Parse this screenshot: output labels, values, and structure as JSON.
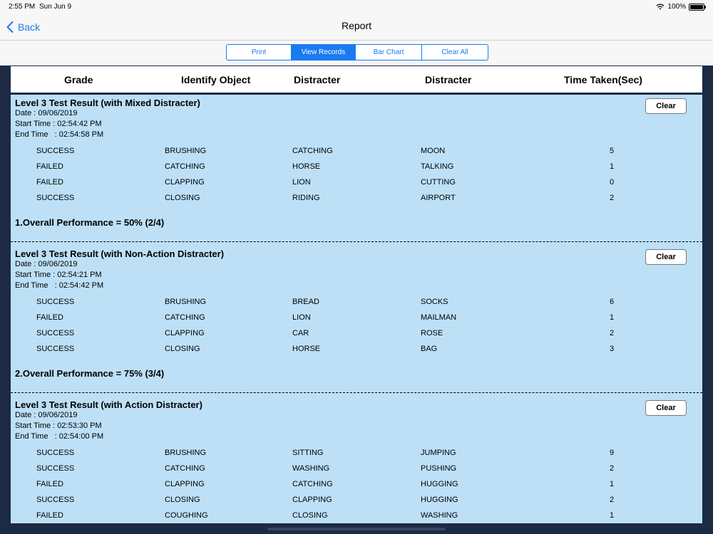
{
  "status": {
    "time": "2:55 PM",
    "date": "Sun Jun 9",
    "battery": "100%"
  },
  "nav": {
    "back_label": "Back",
    "title": "Report"
  },
  "segments": [
    "Print",
    "View Records",
    "Bar Chart",
    "Clear All"
  ],
  "columns": [
    "Grade",
    "Identify Object",
    "Distracter",
    "Distracter",
    "Time Taken(Sec)"
  ],
  "clear_label": "Clear",
  "sections": [
    {
      "title": "Level 3 Test Result (with Mixed Distracter)",
      "date": "Date : 09/06/2019",
      "start": "Start Time : 02:54:42 PM",
      "end": "End Time   : 02:54:58 PM",
      "rows": [
        [
          "SUCCESS",
          "BRUSHING",
          "CATCHING",
          "MOON",
          "5"
        ],
        [
          "FAILED",
          "CATCHING",
          "HORSE",
          "TALKING",
          "1"
        ],
        [
          "FAILED",
          "CLAPPING",
          "LION",
          "CUTTING",
          "0"
        ],
        [
          "SUCCESS",
          "CLOSING",
          "RIDING",
          "AIRPORT",
          "2"
        ]
      ],
      "performance": "1.Overall Performance = 50% (2/4)"
    },
    {
      "title": "Level 3 Test Result (with Non-Action Distracter)",
      "date": "Date : 09/06/2019",
      "start": "Start Time : 02:54:21 PM",
      "end": "End Time   : 02:54:42 PM",
      "rows": [
        [
          "SUCCESS",
          "BRUSHING",
          "BREAD",
          "SOCKS",
          "6"
        ],
        [
          "FAILED",
          "CATCHING",
          "LION",
          "MAILMAN",
          "1"
        ],
        [
          "SUCCESS",
          "CLAPPING",
          "CAR",
          "ROSE",
          "2"
        ],
        [
          "SUCCESS",
          "CLOSING",
          "HORSE",
          "BAG",
          "3"
        ]
      ],
      "performance": "2.Overall Performance = 75% (3/4)"
    },
    {
      "title": "Level 3 Test Result (with Action Distracter)",
      "date": "Date : 09/06/2019",
      "start": "Start Time : 02:53:30 PM",
      "end": "End Time   : 02:54:00 PM",
      "rows": [
        [
          "SUCCESS",
          "BRUSHING",
          "SITTING",
          "JUMPING",
          "9"
        ],
        [
          "SUCCESS",
          "CATCHING",
          "WASHING",
          "PUSHING",
          "2"
        ],
        [
          "FAILED",
          "CLAPPING",
          "CATCHING",
          "HUGGING",
          "1"
        ],
        [
          "SUCCESS",
          "CLOSING",
          "CLAPPING",
          "HUGGING",
          "2"
        ],
        [
          "FAILED",
          "COUGHING",
          "CLOSING",
          "WASHING",
          "1"
        ]
      ],
      "performance": ""
    }
  ]
}
